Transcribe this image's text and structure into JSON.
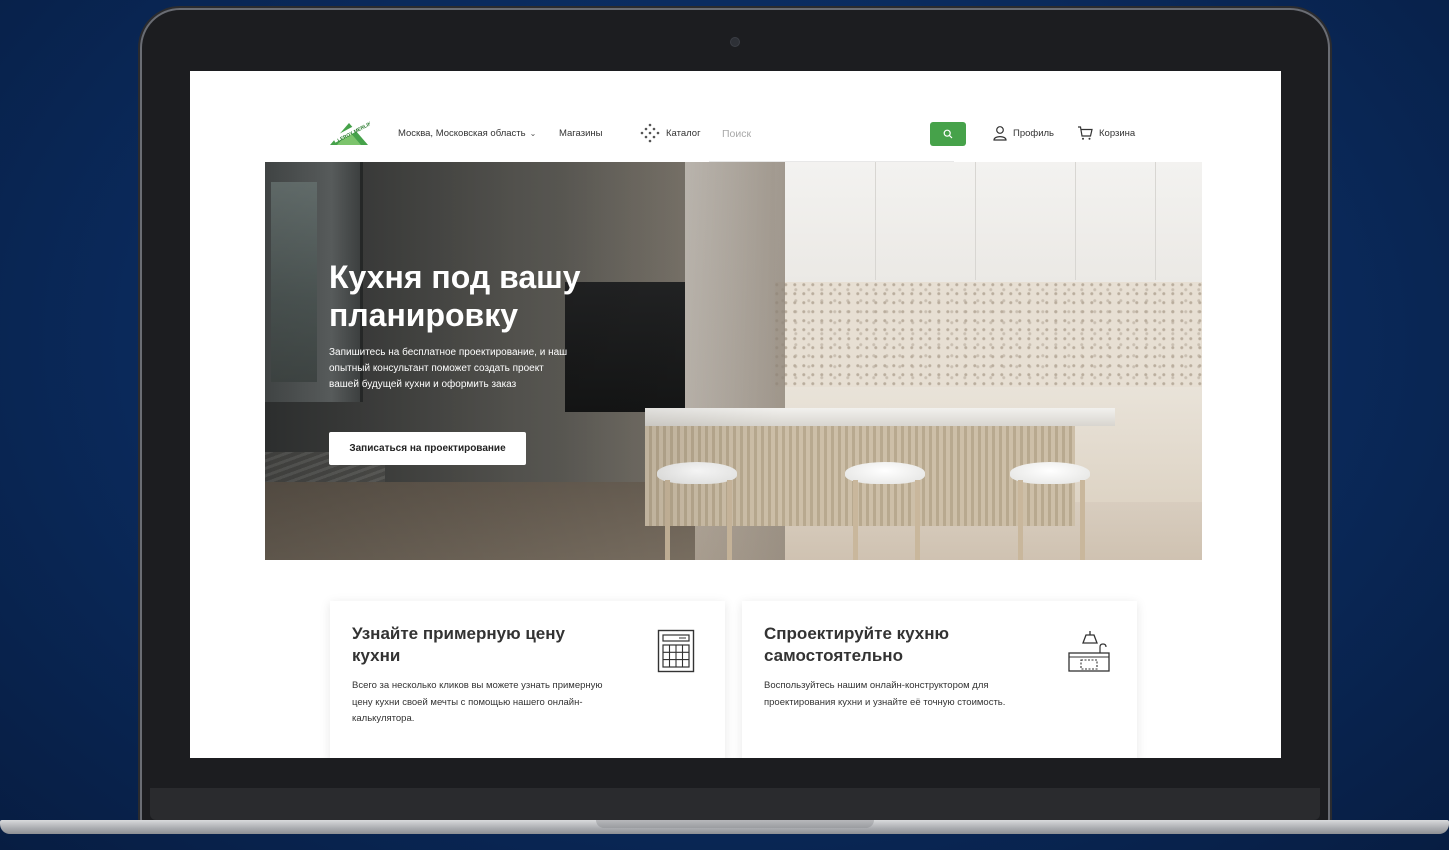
{
  "header": {
    "city": "Москва, Московская область",
    "stores": "Магазины",
    "catalog": "Каталог",
    "search_placeholder": "Поиск",
    "profile": "Профиль",
    "cart": "Корзина"
  },
  "hero": {
    "title": "Кухня под вашу планировку",
    "description": "Запишитесь на бесплатное проектирование, и наш опытный консультант поможет создать проект вашей будущей кухни и оформить заказ",
    "button": "Записаться на проектирование"
  },
  "cards": [
    {
      "title": "Узнайте примерную цену кухни",
      "text": "Всего за несколько кликов вы можете узнать примерную цену кухни своей мечты с помощью нашего онлайн-калькулятора.",
      "icon": "calculator-icon"
    },
    {
      "title": "Спроектируйте кухню самостоятельно",
      "text": "Воспользуйтесь нашим онлайн-конструктором для проектирования кухни и узнайте её точную стоимость.",
      "icon": "kitchen-icon"
    }
  ],
  "colors": {
    "brand_green": "#46a24a",
    "background": "#0a2a5c"
  }
}
